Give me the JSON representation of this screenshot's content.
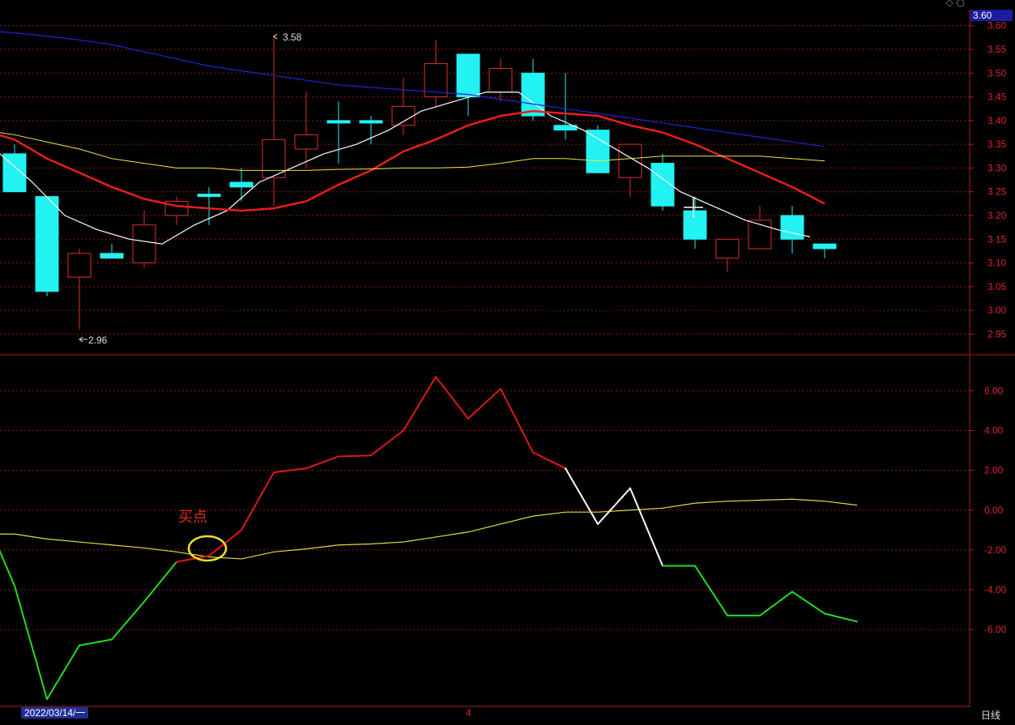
{
  "header": {
    "current_price_label": "3.60",
    "top_icon": "diamond-icon"
  },
  "footer": {
    "date_label": "2022/03/14/一",
    "period_label": "日线",
    "mid_marker": "4"
  },
  "annotations": {
    "high_label": "3.58",
    "low_label": "2.96",
    "buy_point_label": "买点"
  },
  "colors": {
    "up": "#e0302a",
    "down": "#22f2f2",
    "ma_fast": "#ffffff",
    "ma_mid": "#ee1c1c",
    "ma_slow": "#e8e84a",
    "ma_long": "#2222dd",
    "grid": "#b11a1a",
    "osc_up": "#e01818",
    "osc_down": "#22dd22",
    "osc_neutral": "#ffffff",
    "osc_signal": "#dede40",
    "buy_circle": "#f0e020"
  },
  "chart_data": [
    {
      "type": "candlestick",
      "ylim": [
        2.92,
        3.62
      ],
      "y_ticks": [
        "2.95",
        "3.00",
        "3.05",
        "3.10",
        "3.15",
        "3.20",
        "3.25",
        "3.30",
        "3.35",
        "3.40",
        "3.45",
        "3.50",
        "3.55",
        "3.60"
      ],
      "candles": [
        {
          "open": 3.33,
          "close": 3.25,
          "high": 3.35,
          "low": 3.25
        },
        {
          "open": 3.24,
          "close": 3.04,
          "high": 3.24,
          "low": 3.03
        },
        {
          "open": 3.07,
          "close": 3.12,
          "high": 3.13,
          "low": 2.96
        },
        {
          "open": 3.12,
          "close": 3.11,
          "high": 3.14,
          "low": 3.11
        },
        {
          "open": 3.1,
          "close": 3.18,
          "high": 3.21,
          "low": 3.09
        },
        {
          "open": 3.2,
          "close": 3.23,
          "high": 3.24,
          "low": 3.18
        },
        {
          "open": 3.245,
          "close": 3.24,
          "high": 3.26,
          "low": 3.18
        },
        {
          "open": 3.27,
          "close": 3.26,
          "high": 3.3,
          "low": 3.23
        },
        {
          "open": 3.28,
          "close": 3.36,
          "high": 3.58,
          "low": 3.22
        },
        {
          "open": 3.34,
          "close": 3.37,
          "high": 3.46,
          "low": 3.3
        },
        {
          "open": 3.4,
          "close": 3.395,
          "high": 3.44,
          "low": 3.31
        },
        {
          "open": 3.4,
          "close": 3.395,
          "high": 3.41,
          "low": 3.35
        },
        {
          "open": 3.39,
          "close": 3.43,
          "high": 3.49,
          "low": 3.37
        },
        {
          "open": 3.45,
          "close": 3.52,
          "high": 3.57,
          "low": 3.43
        },
        {
          "open": 3.54,
          "close": 3.45,
          "high": 3.54,
          "low": 3.41
        },
        {
          "open": 3.46,
          "close": 3.51,
          "high": 3.53,
          "low": 3.44
        },
        {
          "open": 3.5,
          "close": 3.41,
          "high": 3.53,
          "low": 3.4
        },
        {
          "open": 3.39,
          "close": 3.38,
          "high": 3.5,
          "low": 3.36
        },
        {
          "open": 3.38,
          "close": 3.29,
          "high": 3.39,
          "low": 3.29
        },
        {
          "open": 3.28,
          "close": 3.35,
          "high": 3.35,
          "low": 3.24
        },
        {
          "open": 3.31,
          "close": 3.22,
          "high": 3.33,
          "low": 3.21
        },
        {
          "open": 3.21,
          "close": 3.15,
          "high": 3.24,
          "low": 3.13
        },
        {
          "open": 3.11,
          "close": 3.15,
          "high": 3.15,
          "low": 3.08
        },
        {
          "open": 3.13,
          "close": 3.19,
          "high": 3.22,
          "low": 3.13
        },
        {
          "open": 3.2,
          "close": 3.15,
          "high": 3.22,
          "low": 3.12
        },
        {
          "open": 3.14,
          "close": 3.13,
          "high": 3.14,
          "low": 3.11
        }
      ],
      "series": [
        {
          "id": "ma_fast",
          "values": [
            3.33,
            3.27,
            3.2,
            3.17,
            3.15,
            3.14,
            3.18,
            3.21,
            3.27,
            3.3,
            3.33,
            3.35,
            3.38,
            3.42,
            3.44,
            3.46,
            3.46,
            3.41,
            3.38,
            3.34,
            3.3,
            3.25,
            3.22,
            3.19,
            3.17,
            3.155
          ]
        },
        {
          "id": "ma_mid",
          "values": [
            3.38,
            3.36,
            3.32,
            3.29,
            3.26,
            3.235,
            3.22,
            3.215,
            3.21,
            3.215,
            3.23,
            3.265,
            3.295,
            3.335,
            3.36,
            3.39,
            3.41,
            3.42,
            3.415,
            3.41,
            3.39,
            3.375,
            3.35,
            3.32,
            3.29,
            3.26,
            3.225
          ]
        },
        {
          "id": "ma_slow",
          "values": [
            3.38,
            3.37,
            3.355,
            3.34,
            3.32,
            3.31,
            3.3,
            3.3,
            3.295,
            3.295,
            3.295,
            3.297,
            3.298,
            3.3,
            3.3,
            3.302,
            3.31,
            3.32,
            3.32,
            3.315,
            3.32,
            3.325,
            3.325,
            3.325,
            3.325,
            3.32,
            3.315
          ]
        },
        {
          "id": "ma_long",
          "values": [
            3.59,
            3.585,
            3.578,
            3.57,
            3.56,
            3.545,
            3.53,
            3.515,
            3.505,
            3.495,
            3.485,
            3.475,
            3.47,
            3.465,
            3.46,
            3.455,
            3.445,
            3.435,
            3.425,
            3.415,
            3.405,
            3.395,
            3.385,
            3.375,
            3.365,
            3.355,
            3.345
          ]
        }
      ]
    },
    {
      "type": "line",
      "ylim": [
        -9.7,
        7.4
      ],
      "y_ticks": [
        "6.00",
        "4.00",
        "2.00",
        "0.00",
        "-2.00",
        "-4.00",
        "-6.00"
      ],
      "main": [
        0,
        -3.8,
        -9.5,
        -6.8,
        -6.5,
        -4.6,
        -2.6,
        -2.3,
        -1.0,
        1.9,
        2.1,
        2.7,
        2.75,
        4.0,
        6.7,
        4.6,
        6.1,
        2.9,
        2.1,
        -0.7,
        1.1,
        -2.8,
        -2.8,
        -5.3,
        -5.3,
        -4.1,
        -5.2,
        -5.6
      ],
      "signal": [
        -1.2,
        -1.2,
        -1.45,
        -1.6,
        -1.75,
        -1.9,
        -2.1,
        -2.35,
        -2.45,
        -2.1,
        -1.95,
        -1.75,
        -1.7,
        -1.6,
        -1.35,
        -1.1,
        -0.7,
        -0.3,
        -0.1,
        -0.1,
        0.0,
        0.1,
        0.35,
        0.45,
        0.5,
        0.55,
        0.45,
        0.25
      ],
      "main_colors": [
        "down",
        "down",
        "down",
        "down",
        "down",
        "down",
        "down",
        "up",
        "up",
        "up",
        "up",
        "up",
        "up",
        "up",
        "up",
        "up",
        "up",
        "up",
        "up",
        "neutral",
        "neutral",
        "neutral",
        "down",
        "down",
        "down",
        "down",
        "down",
        "down"
      ]
    }
  ]
}
